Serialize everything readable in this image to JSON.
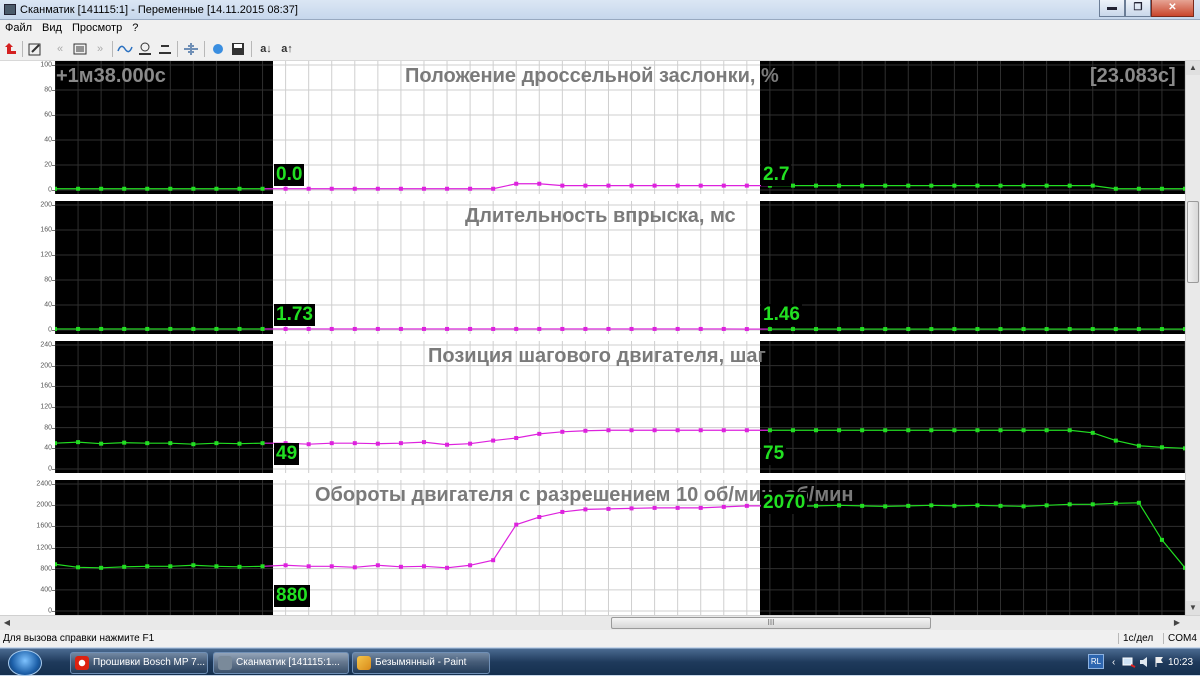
{
  "window": {
    "title": "Сканматик [141115:1] - Переменные [14.11.2015  08:37]",
    "minimize": "▬",
    "maximize": "❐",
    "close": "✕"
  },
  "menu": [
    "Файл",
    "Вид",
    "Просмотр",
    "?"
  ],
  "toolbar": {
    "back_icon": "red-arrow-icon",
    "items": [
      "a↓",
      "a↑"
    ]
  },
  "time_left": "+1м38.000с",
  "time_right": "[23.083с]",
  "colors": {
    "trace_live": "#22dd22",
    "trace_selected": "#dd22dd",
    "dark_bg": "#000000",
    "value_text": "#22e022"
  },
  "charts": [
    {
      "title": "Положение дроссельной заслонки, %",
      "yticks": [
        "100",
        "80",
        "60",
        "40",
        "20",
        "0"
      ],
      "ymax": 100,
      "value_left": "0.0",
      "value_right": "2.7",
      "series": [
        1,
        1,
        1,
        1,
        1,
        1,
        1,
        1,
        1,
        1,
        1,
        1,
        1,
        1,
        1,
        1,
        1,
        1,
        1,
        1,
        5,
        5,
        3.5,
        3.5,
        3.5,
        3.5,
        3.5,
        3.5,
        3.5,
        3.5,
        3.5,
        3.5,
        3.5,
        3.5,
        3.5,
        3.5,
        3.5,
        3.5,
        3.5,
        3.5,
        3.5,
        3.5,
        3.5,
        3.5,
        3.5,
        3.5,
        1,
        1,
        1,
        1
      ]
    },
    {
      "title": "Длительность впрыска, мс",
      "yticks": [
        "200",
        "160",
        "120",
        "80",
        "40",
        "0"
      ],
      "ymax": 200,
      "value_left": "1.73",
      "value_right": "1.46",
      "series": [
        1.7,
        1.7,
        1.7,
        1.7,
        1.7,
        1.7,
        1.7,
        1.7,
        1.7,
        1.7,
        1.7,
        1.7,
        1.7,
        1.7,
        1.7,
        1.7,
        1.7,
        1.7,
        1.7,
        1.7,
        1.7,
        1.7,
        1.7,
        1.7,
        1.7,
        1.7,
        1.7,
        1.7,
        1.7,
        1.7,
        1.5,
        1.5,
        1.5,
        1.5,
        1.5,
        1.5,
        1.5,
        1.5,
        1.5,
        1.5,
        1.5,
        1.5,
        1.5,
        1.5,
        1.5,
        1.5,
        1.5,
        1.5,
        1.5,
        1.5
      ]
    },
    {
      "title": "Позиция шагового двигателя, шаг",
      "yticks": [
        "240",
        "200",
        "160",
        "120",
        "80",
        "40",
        "0"
      ],
      "ymax": 240,
      "value_left": "49",
      "value_right": "75",
      "series": [
        50,
        52,
        49,
        51,
        50,
        50,
        48,
        50,
        49,
        50,
        50,
        48,
        50,
        50,
        49,
        50,
        52,
        47,
        49,
        55,
        60,
        68,
        72,
        74,
        75,
        75,
        75,
        75,
        75,
        75,
        75,
        75,
        75,
        75,
        75,
        75,
        75,
        75,
        75,
        75,
        75,
        75,
        75,
        75,
        75,
        70,
        55,
        45,
        42,
        40
      ]
    },
    {
      "title": "Обороты двигателя с разрешением 10 об/мин, об/мин",
      "yticks": [
        "2400",
        "2000",
        "1600",
        "1200",
        "800",
        "400",
        "0"
      ],
      "ymax": 2500,
      "value_left": "880",
      "value_right": "2070",
      "series": [
        920,
        860,
        850,
        870,
        880,
        880,
        900,
        880,
        870,
        880,
        900,
        880,
        880,
        860,
        900,
        870,
        880,
        850,
        900,
        1000,
        1700,
        1850,
        1950,
        2000,
        2010,
        2020,
        2030,
        2030,
        2030,
        2050,
        2070,
        2070,
        2060,
        2070,
        2080,
        2070,
        2060,
        2070,
        2080,
        2070,
        2080,
        2070,
        2060,
        2080,
        2100,
        2100,
        2120,
        2130,
        1400,
        850
      ]
    }
  ],
  "statusbar": {
    "help": "Для вызова справки нажмите F1",
    "scale": "1с/дел",
    "port": "COM4"
  },
  "taskbar": {
    "tasks": [
      {
        "label": "Прошивки Bosch MP 7...",
        "icon": "opera-icon"
      },
      {
        "label": "Сканматик [141115:1...",
        "icon": "scanmatik-icon"
      },
      {
        "label": "Безымянный - Paint",
        "icon": "paint-icon"
      }
    ],
    "lang": "RL",
    "clock": "10:23"
  },
  "hscroll_label": "III"
}
